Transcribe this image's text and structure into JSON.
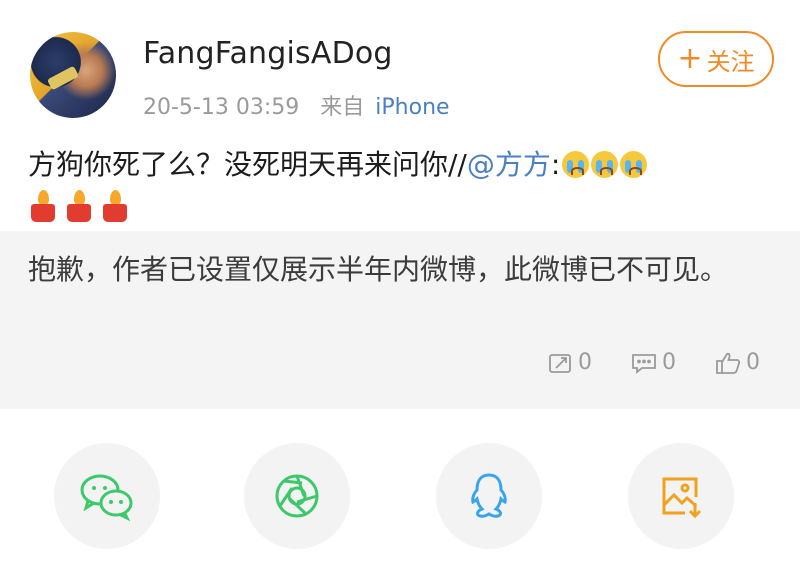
{
  "post": {
    "username": "FangFangisADog",
    "timestamp": "20-5-13 03:59",
    "source_prefix": "来自",
    "source": "iPhone",
    "follow_label": "关注",
    "follow_plus": "+",
    "text_main": "方狗你死了么？没死明天再来问你//",
    "mention": "@方方",
    "mention_colon": ":",
    "emoji": [
      "crying-face",
      "crying-face",
      "crying-face",
      "candle",
      "candle",
      "candle"
    ]
  },
  "repost": {
    "text": "抱歉，作者已设置仅展示半年内微博，此微博已不可见。",
    "repost_count": "0",
    "comment_count": "0",
    "like_count": "0"
  },
  "share": {
    "items": [
      "wechat-icon",
      "moments-icon",
      "qq-icon",
      "save-image-icon"
    ]
  },
  "colors": {
    "accent_orange": "#f08a26",
    "link_blue": "#4a7fc1",
    "wechat_green": "#3cc86b",
    "qq_blue": "#37a4ec",
    "save_orange": "#f0a21e"
  }
}
